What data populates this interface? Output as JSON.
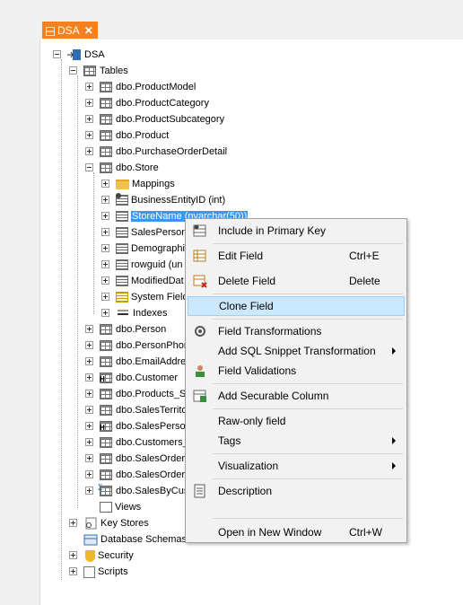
{
  "tab": {
    "label": "DSA",
    "close_glyph": "✕"
  },
  "tree": {
    "root": "DSA",
    "tables_label": "Tables",
    "tables_before": [
      "dbo.ProductModel",
      "dbo.ProductCategory",
      "dbo.ProductSubcategory",
      "dbo.Product",
      "dbo.PurchaseOrderDetail"
    ],
    "store_label": "dbo.Store",
    "store_children": {
      "mappings": "Mappings",
      "business_entity": "BusinessEntityID (int)",
      "store_name_selected": "StoreName (nvarchar(50))",
      "sales_person": "SalesPerson",
      "demographics": "Demographi",
      "rowguid": "rowguid (un",
      "modified_date": "ModifiedDat",
      "system_fields": "System Field",
      "indexes": "Indexes"
    },
    "tables_after": [
      "dbo.Person",
      "dbo.PersonPhon",
      "dbo.EmailAddre",
      "dbo.Customer",
      "dbo.Products_S",
      "dbo.SalesTerrito",
      "dbo.SalesPerso",
      "dbo.Customers_",
      "dbo.SalesOrder",
      "dbo.SalesOrder",
      "dbo.SalesByCus"
    ],
    "views_label": "Views",
    "key_stores_label": "Key Stores",
    "db_schemas_label": "Database Schemas",
    "security_label": "Security",
    "scripts_label": "Scripts"
  },
  "context_menu": {
    "items": [
      {
        "label": "Include in Primary Key",
        "shortcut": "",
        "icon": "primary-key-icon"
      },
      {
        "label": "Edit Field",
        "shortcut": "Ctrl+E",
        "icon": "edit-field-icon"
      },
      {
        "label": "Delete Field",
        "shortcut": "Delete",
        "icon": "delete-field-icon"
      },
      {
        "label": "Clone Field",
        "shortcut": "",
        "icon": "",
        "highlighted": true
      },
      {
        "label": "Field Transformations",
        "shortcut": "",
        "icon": "transformations-icon"
      },
      {
        "label": "Add SQL Snippet Transformation",
        "shortcut": "",
        "submenu": true
      },
      {
        "label": "Field Validations",
        "shortcut": "",
        "icon": "validations-icon"
      },
      {
        "label": "Add Securable Column",
        "shortcut": "",
        "icon": "securable-column-icon"
      },
      {
        "label": "Raw-only field",
        "shortcut": ""
      },
      {
        "label": "Tags",
        "shortcut": "",
        "submenu": true
      },
      {
        "label": "Visualization",
        "shortcut": "",
        "submenu": true
      },
      {
        "label": "Description",
        "shortcut": "",
        "icon": "description-icon"
      },
      {
        "label": "Open in New Window",
        "shortcut": "Ctrl+W"
      }
    ]
  }
}
